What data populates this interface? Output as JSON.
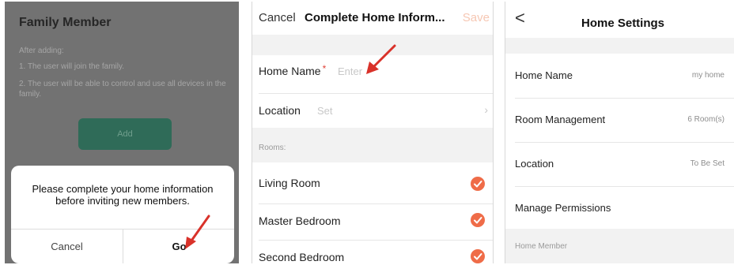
{
  "panel1": {
    "title": "Family Member",
    "after_adding": "After adding:",
    "line1": "1. The user will join the family.",
    "line2": "2. The user will be able to control and use all devices in the family.",
    "add_button": "Add",
    "dialog": {
      "message": "Please complete your home information before inviting new members.",
      "cancel": "Cancel",
      "go": "Go"
    }
  },
  "panel2": {
    "cancel": "Cancel",
    "title": "Complete Home Inform...",
    "save": "Save",
    "home_name_label": "Home Name",
    "required_mark": "*",
    "home_name_placeholder": "Enter",
    "location_label": "Location",
    "location_placeholder": "Set",
    "rooms_caption": "Rooms:",
    "rooms": [
      {
        "name": "Living Room",
        "checked": true
      },
      {
        "name": "Master Bedroom",
        "checked": true
      },
      {
        "name": "Second Bedroom",
        "checked": true
      }
    ]
  },
  "panel3": {
    "title": "Home Settings",
    "rows": [
      {
        "label": "Home Name",
        "value": "my home"
      },
      {
        "label": "Room Management",
        "value": "6 Room(s)"
      },
      {
        "label": "Location",
        "value": "To Be Set"
      },
      {
        "label": "Manage Permissions",
        "value": ""
      }
    ],
    "home_member_caption": "Home Member"
  },
  "colors": {
    "accent": "#ef6c48",
    "arrow": "#d9322a",
    "add_button": "#2f6b58",
    "overlay": "#727272"
  },
  "icons": [
    "back-chevron-icon",
    "chevron-right-icon",
    "check-circle-icon",
    "red-arrow-icon"
  ]
}
